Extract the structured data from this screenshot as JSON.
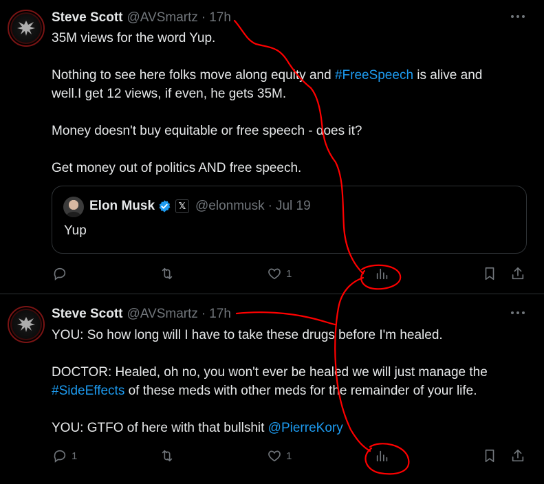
{
  "tweets": [
    {
      "author_name": "Steve Scott",
      "author_handle": "@AVSmartz",
      "separator": "·",
      "time": "17h",
      "text_lines": {
        "l1": "35M views for the word Yup.",
        "l2a": "Nothing to see here folks move along equity and ",
        "l2_hashtag": "#FreeSpeech",
        "l2b": " is alive and",
        "l3": "well.I get 12 views, if even, he gets 35M.",
        "l4": "Money doesn't buy equitable or free speech - does it?",
        "l5": "Get money out of politics AND free speech."
      },
      "quote": {
        "author_name": "Elon Musk",
        "x_badge": "𝕏",
        "author_handle": "@elonmusk",
        "separator": "·",
        "date": "Jul 19",
        "text": "Yup"
      },
      "actions": {
        "replies": "",
        "reposts": "",
        "likes": "1"
      }
    },
    {
      "author_name": "Steve Scott",
      "author_handle": "@AVSmartz",
      "separator": "·",
      "time": "17h",
      "text_lines": {
        "l1": "YOU: So how long will I have to take these drugs before I'm healed.",
        "l2": "DOCTOR: Healed, oh no, you won't ever be healed we will just manage the",
        "l3_hashtag": "#SideEffects",
        "l3b": " of these meds with other meds for the remainder of your life.",
        "l4a": "YOU: GTFO of here with that bullshit ",
        "l4_mention": "@PierreKory"
      },
      "actions": {
        "replies": "1",
        "reposts": "",
        "likes": "1"
      }
    }
  ],
  "icons": {
    "more": "more-horizontal-icon",
    "reply": "reply-icon",
    "repost": "repost-icon",
    "like": "heart-icon",
    "views": "views-chart-icon",
    "bookmark": "bookmark-icon",
    "share": "share-icon",
    "verified": "verified-badge-icon"
  },
  "colors": {
    "background": "#000000",
    "text": "#e7e9ea",
    "muted": "#71767b",
    "link": "#1d9bf0",
    "border": "#2f3336",
    "annotation": "#ff0000"
  }
}
